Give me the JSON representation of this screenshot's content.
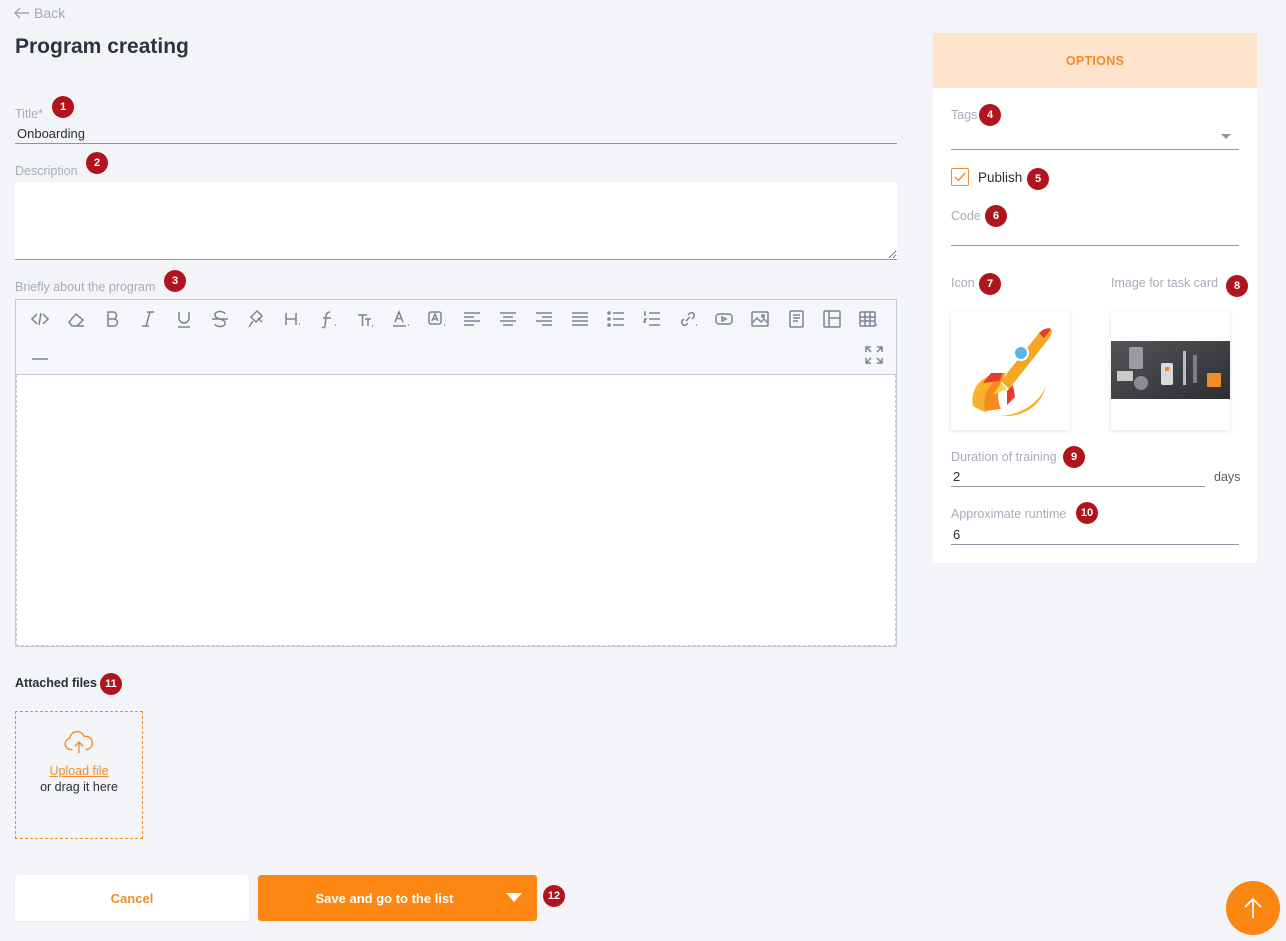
{
  "nav": {
    "back_label": "Back"
  },
  "page": {
    "title": "Program creating"
  },
  "form": {
    "title_label": "Title*",
    "title_value": "Onboarding",
    "description_label": "Description",
    "description_value": "",
    "about_label": "Briefly about the program",
    "attached_label": "Attached files",
    "upload_link": "Upload file",
    "drag_text": "or drag it here"
  },
  "toolbar_icons": [
    "code-view-icon",
    "eraser-icon",
    "bold-icon",
    "italic-icon",
    "underline-icon",
    "strikethrough-icon",
    "format-painter-icon",
    "heading-icon",
    "font-family-icon",
    "font-size-icon",
    "text-color-icon",
    "background-color-icon",
    "align-left-icon",
    "align-center-icon",
    "align-right-icon",
    "align-justify-icon",
    "bullet-list-icon",
    "numbered-list-icon",
    "link-icon",
    "video-icon",
    "image-icon",
    "file-icon",
    "layout-icon",
    "table-icon",
    "horizontal-line-icon",
    "fullscreen-icon"
  ],
  "options": {
    "header": "OPTIONS",
    "tags_label": "Tags",
    "tags_value": "",
    "publish_label": "Publish",
    "publish_checked": true,
    "code_label": "Code",
    "code_value": "",
    "icon_label": "Icon",
    "image_label": "Image for task card",
    "duration_label": "Duration of training",
    "duration_value": "2",
    "duration_unit": "days",
    "runtime_label": "Approximate runtime",
    "runtime_value": "6"
  },
  "actions": {
    "cancel_label": "Cancel",
    "save_label": "Save and go to the list"
  },
  "badges": [
    "1",
    "2",
    "3",
    "4",
    "5",
    "6",
    "7",
    "8",
    "9",
    "10",
    "11",
    "12"
  ],
  "colors": {
    "accent": "#fb8612",
    "accent_text": "#f28c28",
    "badge": "#b0141d",
    "options_header_bg": "#fde3cb"
  }
}
